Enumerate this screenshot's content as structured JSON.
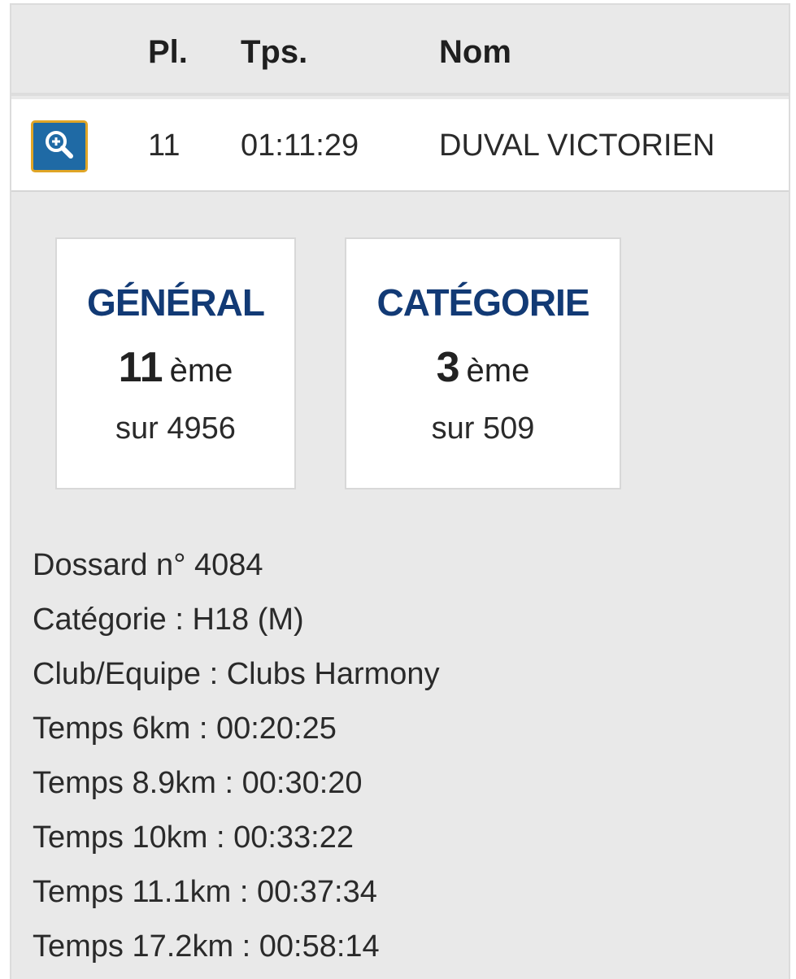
{
  "table": {
    "headers": {
      "place": "Pl.",
      "time": "Tps.",
      "name": "Nom"
    },
    "row": {
      "place": "11",
      "time": "01:11:29",
      "name": "DUVAL VICTORIEN",
      "zoom_icon": "zoom-in-icon"
    }
  },
  "cards": {
    "general": {
      "title": "GÉNÉRAL",
      "rank": "11",
      "suffix": "ème",
      "total": "sur 4956"
    },
    "category": {
      "title": "CATÉGORIE",
      "rank": "3",
      "suffix": "ème",
      "total": "sur 509"
    }
  },
  "details": [
    "Dossard n° 4084",
    "Catégorie : H18 (M)",
    "Club/Equipe : Clubs Harmony",
    "Temps 6km : 00:20:25",
    "Temps 8.9km : 00:30:20",
    "Temps 10km : 00:33:22",
    "Temps 11.1km : 00:37:34",
    "Temps 17.2km : 00:58:14"
  ],
  "colors": {
    "title_blue": "#123a75",
    "button_blue": "#1f6aa5",
    "button_border": "#e0a526",
    "background": "#e9e9e9"
  }
}
